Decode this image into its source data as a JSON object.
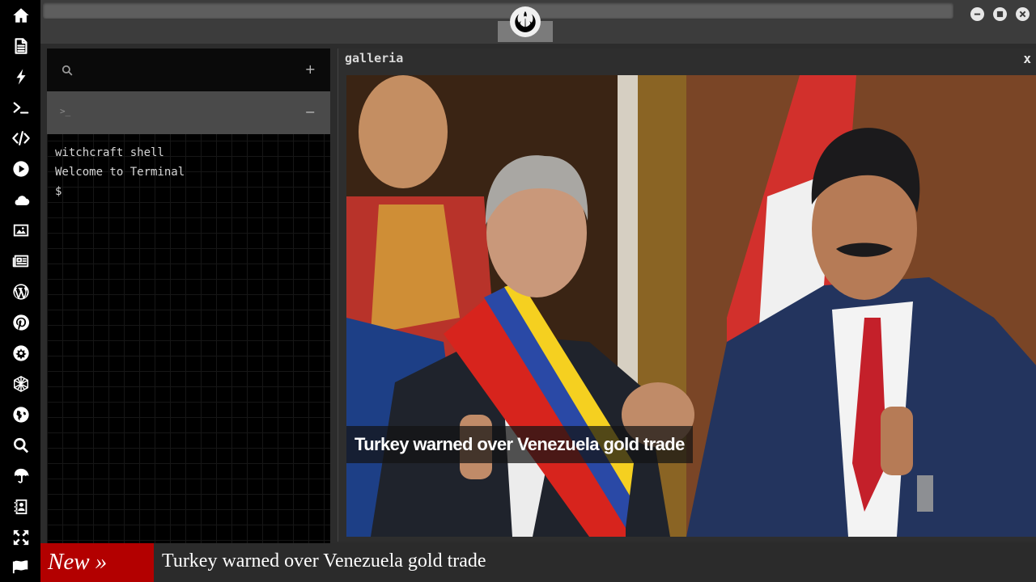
{
  "sidebar": {
    "icons": [
      "home-icon",
      "document-icon",
      "bolt-icon",
      "terminal-icon",
      "code-icon",
      "play-icon",
      "cloud-icon",
      "image-icon",
      "newspaper-icon",
      "wordpress-icon",
      "pinterest-icon",
      "network-icon",
      "geometry-icon",
      "globe-icon",
      "search-icon",
      "umbrella-icon",
      "contact-book-icon",
      "move-icon",
      "flag-icon"
    ]
  },
  "topbar": {
    "logo": "rebel-alliance-logo-icon",
    "window_controls": [
      "minimize-icon",
      "maximize-icon",
      "close-icon"
    ]
  },
  "terminal": {
    "search_icon": "search-icon",
    "add_label": "+",
    "tab_prompt": ">_",
    "collapse_label": "−",
    "lines": [
      "witchcraft shell",
      "Welcome to Terminal",
      "$"
    ]
  },
  "gallery": {
    "title": "galleria",
    "close_label": "x",
    "caption": "Turkey warned over Venezuela gold trade"
  },
  "ticker": {
    "tag": "New »",
    "headline": "Turkey warned over Venezuela gold trade"
  },
  "colors": {
    "rail_background": "#000000",
    "ticker_tag": "#b30000",
    "window_background": "#2c2c2c"
  }
}
